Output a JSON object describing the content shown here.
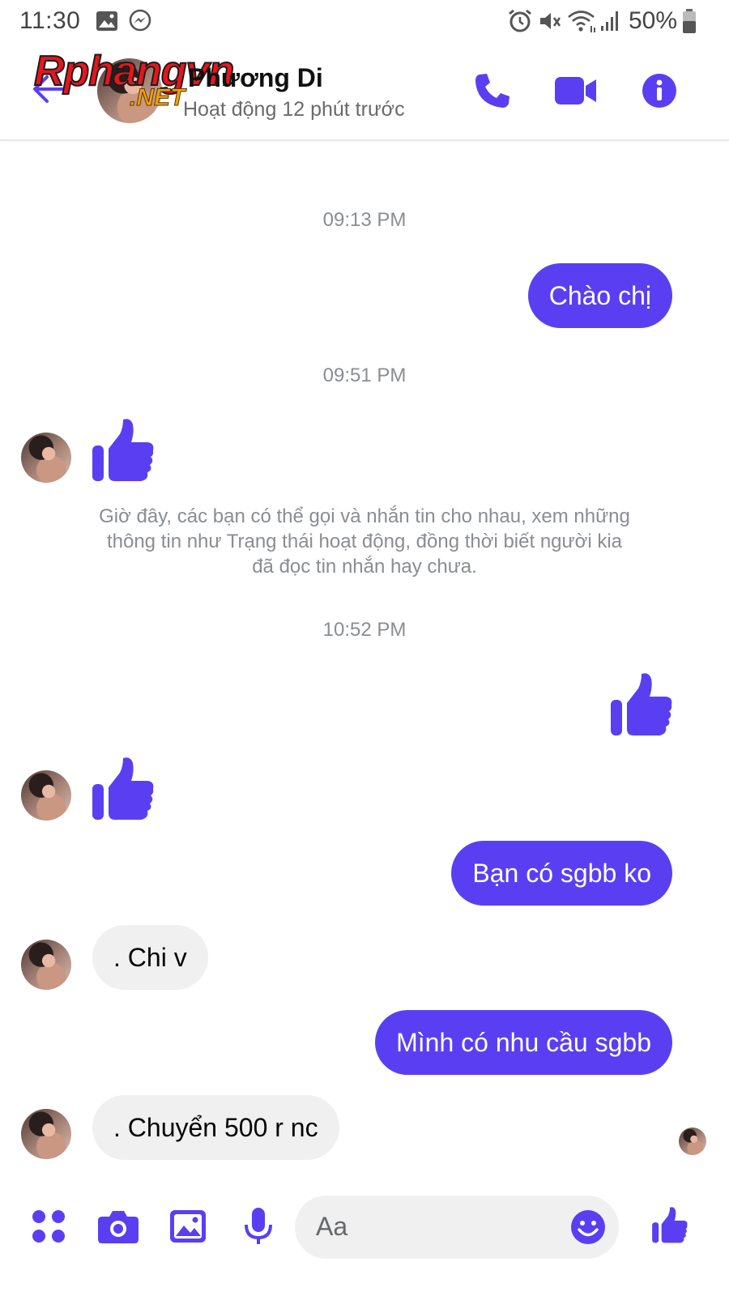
{
  "status_bar": {
    "time": "11:30",
    "battery": "50%",
    "icons": [
      "gallery-icon",
      "messenger-icon",
      "alarm-icon",
      "mute-icon",
      "wifi-icon",
      "signal-icon",
      "battery-icon"
    ]
  },
  "header": {
    "watermark_main": "Rphangvn",
    "watermark_sub": ".NET",
    "contact_name": "Phương Di",
    "contact_status": "Hoạt động 12 phút trước",
    "actions": [
      "phone-icon",
      "video-call-icon",
      "info-icon"
    ]
  },
  "conversation": {
    "timestamps": [
      "09:13 PM",
      "09:51 PM",
      "10:52 PM"
    ],
    "system_notice": "Giờ đây, các bạn có thể gọi và nhắn tin cho nhau, xem những thông tin như Trạng thái hoạt động, đồng thời biết người kia đã đọc tin nhắn hay chưa.",
    "messages": [
      {
        "from": "me",
        "text": "Chào chị"
      },
      {
        "from": "them",
        "kind": "like"
      },
      {
        "from": "me",
        "kind": "like"
      },
      {
        "from": "them",
        "kind": "like"
      },
      {
        "from": "me",
        "text": "Bạn có sgbb ko"
      },
      {
        "from": "them",
        "text": ". Chi v"
      },
      {
        "from": "me",
        "text": "Mình có nhu cầu sgbb"
      },
      {
        "from": "them",
        "text": ". Chuyển 500 r nc"
      }
    ]
  },
  "composer": {
    "placeholder": "Aa",
    "buttons": [
      "menu-icon",
      "camera-icon",
      "gallery-icon",
      "microphone-icon",
      "emoji-icon",
      "like-icon"
    ]
  },
  "colors": {
    "accent": "#5a3ff2",
    "incoming_bubble": "#f0f0f0",
    "meta_text": "#8a8d91"
  }
}
